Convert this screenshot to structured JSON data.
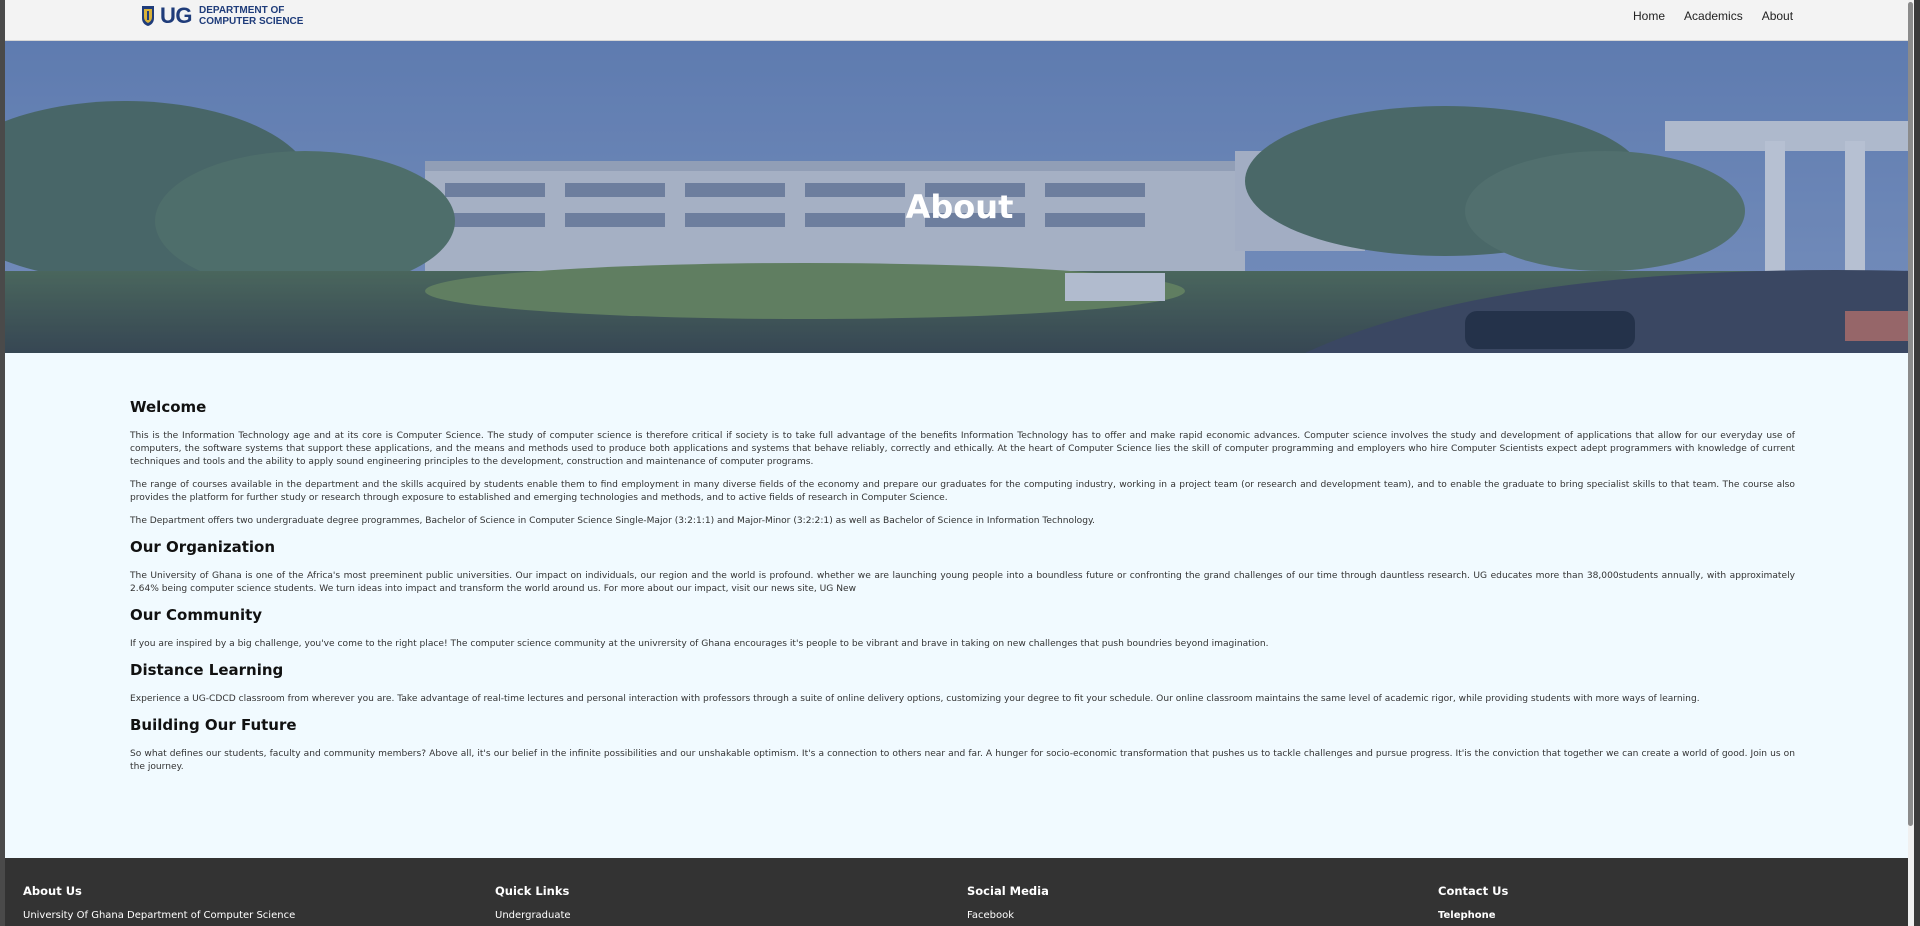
{
  "nav": {
    "logo_ug": "UG",
    "logo_dept_line1": "DEPARTMENT OF",
    "logo_dept_line2": "COMPUTER SCIENCE",
    "links": [
      "Home",
      "Academics",
      "About"
    ]
  },
  "hero": {
    "title": "About"
  },
  "sections": [
    {
      "heading": "Welcome",
      "paragraphs": [
        "This is the Information Technology age and at its core is Computer Science. The study of computer science is therefore critical if society is to take full advantage of the benefits Information Technology has to offer and make rapid economic advances. Computer science involves the study and development of applications that allow for our everyday use of computers, the software systems that support these applications, and the means and methods used to produce both applications and systems that behave reliably, correctly and ethically. At the heart of Computer Science lies the skill of computer programming and employers who hire Computer Scientists expect adept programmers with knowledge of current techniques and tools and the ability to apply sound engineering principles to the development, construction and maintenance of computer programs.",
        "The range of courses available in the department and the skills acquired by students enable them to find employment in many diverse fields of the economy and prepare our graduates for the computing industry, working in a project team (or research and development team), and to enable the graduate to bring specialist skills to that team. The course also provides the platform for further study or research through exposure to established and emerging technologies and methods, and to active fields of research in Computer Science.",
        "The Department offers two undergraduate degree programmes, Bachelor of Science in Computer Science Single-Major (3:2:1:1) and Major-Minor (3:2:2:1) as well as Bachelor of Science in Information Technology."
      ]
    },
    {
      "heading": "Our Organization",
      "paragraphs": [
        "The University of Ghana is one of the Africa's most preeminent public universities. Our impact on individuals, our region and the world is profound. whether we are launching young people into a boundless future or confronting the grand challenges of our time through dauntless research. UG educates more than 38,000students annually, with approximately 2.64% being computer science students. We turn ideas into impact and transform the world around us. For more about our impact, visit our news site, UG New"
      ]
    },
    {
      "heading": "Our Community",
      "paragraphs": [
        "If you are inspired by a big challenge, you've come to the right place! The computer science community at the univrersity of Ghana encourages it's people to be vibrant and brave in taking on new challenges that push boundries beyond imagination."
      ]
    },
    {
      "heading": "Distance Learning",
      "paragraphs": [
        "Experience a UG-CDCD classroom from wherever you are. Take advantage of real-time lectures and personal interaction with professors through a suite of online delivery options, customizing your degree to fit your schedule. Our online classroom maintains the same level of academic rigor, while providing students with more ways of learning."
      ]
    },
    {
      "heading": "Building Our Future",
      "paragraphs": [
        "So what defines our students, faculty and community members? Above all, it's our belief in the infinite possibilities and our unshakable optimism. It's a connection to others near and far. A hunger for socio-economic transformation that pushes us to tackle challenges and pursue progress. It'is the conviction that together we can create a world of good. Join us on the journey."
      ]
    }
  ],
  "footer": {
    "about": {
      "title": "About Us",
      "item": "University Of Ghana Department of Computer Science"
    },
    "quick_links": {
      "title": "Quick Links",
      "item": "Undergraduate"
    },
    "social": {
      "title": "Social Media",
      "item": "Facebook"
    },
    "contact": {
      "title": "Contact Us",
      "item": "Telephone"
    }
  },
  "colors": {
    "brand": "#1f3c7a",
    "footer_bg": "#333333",
    "page_bg": "#f1faff"
  }
}
